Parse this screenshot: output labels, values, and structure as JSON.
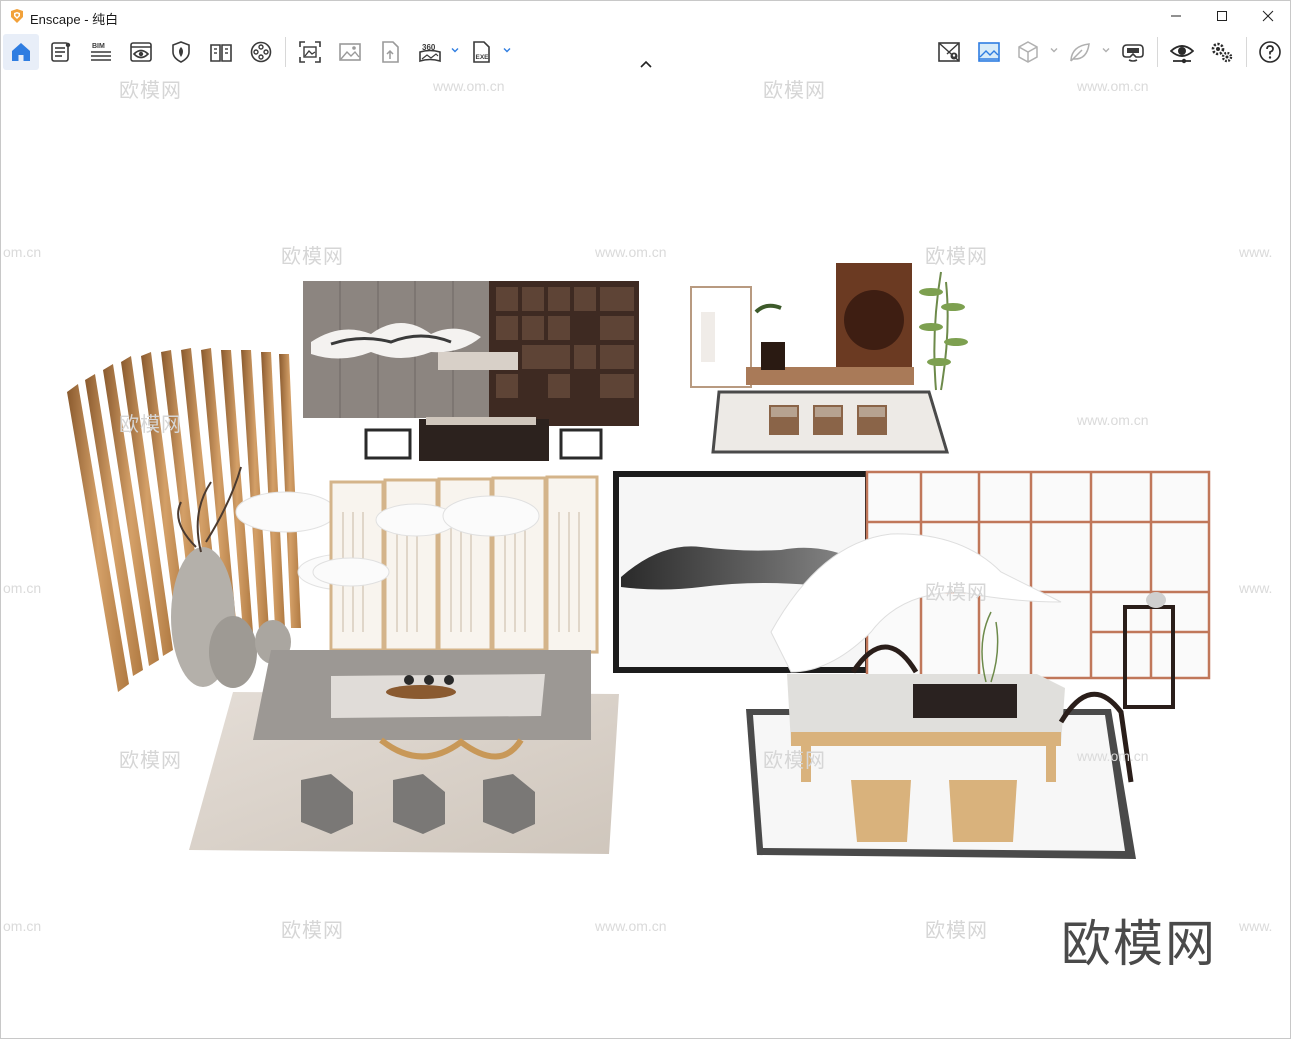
{
  "window": {
    "app_name": "Enscape",
    "title": "Enscape - 纯白",
    "controls": [
      "minimize",
      "maximize",
      "close"
    ]
  },
  "toolbar": {
    "left_buttons": [
      {
        "name": "home",
        "icon": "home-icon",
        "active": true
      },
      {
        "name": "info",
        "icon": "document-list-icon"
      },
      {
        "name": "bim",
        "icon": "bim-icon",
        "label": "BIM"
      },
      {
        "name": "view",
        "icon": "eye-view-icon"
      },
      {
        "name": "asset",
        "icon": "shield-leaf-icon"
      },
      {
        "name": "book",
        "icon": "book-icon"
      },
      {
        "name": "video",
        "icon": "film-reel-icon"
      }
    ],
    "mid_buttons": [
      {
        "name": "screenshot",
        "icon": "screenshot-icon"
      },
      {
        "name": "batch",
        "icon": "image-icon"
      },
      {
        "name": "upload",
        "icon": "upload-file-icon"
      },
      {
        "name": "panorama",
        "icon": "panorama-360-icon",
        "label": "360"
      },
      {
        "name": "export",
        "icon": "exe-export-icon",
        "label": "EXE"
      }
    ],
    "right_buttons": [
      {
        "name": "map",
        "icon": "map-pin-icon"
      },
      {
        "name": "atmosphere",
        "icon": "atmosphere-icon"
      },
      {
        "name": "cube",
        "icon": "cube-icon"
      },
      {
        "name": "leaf",
        "icon": "leaf-icon"
      },
      {
        "name": "vr",
        "icon": "vr-headset-icon"
      },
      {
        "name": "visual",
        "icon": "eye-settings-icon"
      },
      {
        "name": "settings",
        "icon": "gears-icon"
      },
      {
        "name": "help",
        "icon": "help-icon",
        "label": "?"
      }
    ]
  },
  "watermarks": {
    "cn": "欧模网",
    "url": "www.om.cn",
    "url_fragment_left": "om.cn",
    "url_fragment_right": "www."
  },
  "brand_watermark": "欧模网",
  "colors": {
    "accent_blue": "#2f7de1",
    "icon_gray": "#3a3a3a",
    "wood": "#c8955a",
    "dark_wood": "#5a3a24"
  }
}
